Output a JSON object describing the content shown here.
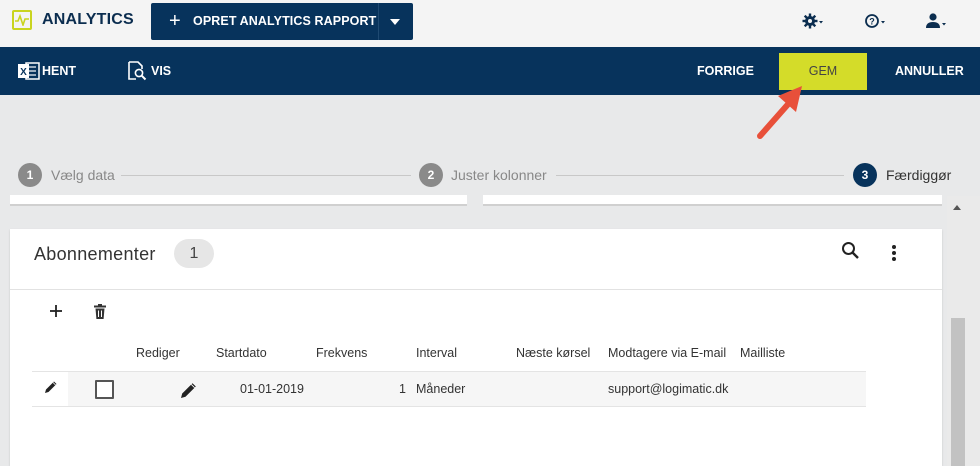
{
  "app": {
    "title": "ANALYTICS"
  },
  "header": {
    "create_button_label": "OPRET ANALYTICS RAPPORT",
    "icons": [
      "settings-icon",
      "help-icon",
      "user-icon"
    ]
  },
  "nav": {
    "left": [
      {
        "label": "HENT",
        "icon": "excel-icon"
      },
      {
        "label": "VIS",
        "icon": "preview-icon"
      }
    ],
    "right": {
      "prev": "FORRIGE",
      "save": "GEM",
      "cancel": "ANNULLER"
    }
  },
  "steps": [
    {
      "num": "1",
      "label": "Vælg data",
      "state": "done"
    },
    {
      "num": "2",
      "label": "Juster kolonner",
      "state": "done"
    },
    {
      "num": "3",
      "label": "Færdiggør",
      "state": "active"
    }
  ],
  "subscriptions": {
    "title": "Abonnementer",
    "count": "1",
    "columns": [
      "Rediger",
      "Startdato",
      "Frekvens",
      "Interval",
      "Næste kørsel",
      "Modtagere via E-mail",
      "Mailliste"
    ],
    "rows": [
      {
        "start": "01-01-2019",
        "frequency": "1",
        "interval": "Måneder",
        "next_run": "",
        "recipients": "support@logimatic.dk",
        "maillist": ""
      }
    ]
  },
  "colors": {
    "navy": "#07335c",
    "accent": "#d4dc29",
    "annotation_arrow": "#e8503a"
  }
}
